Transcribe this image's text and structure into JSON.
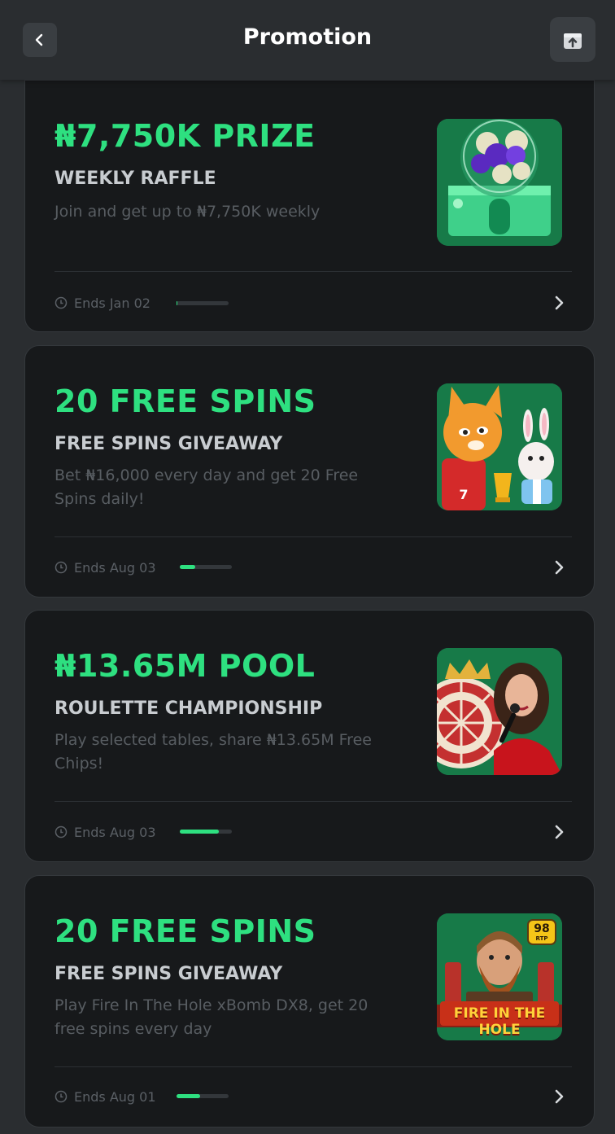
{
  "header": {
    "title": "Promotion",
    "back_icon": "chevron-left-icon",
    "share_icon": "share-upload-icon"
  },
  "colors": {
    "accent": "#2ee080",
    "card_bg": "#17191b",
    "page_bg": "#2a2d30",
    "thumb_bg": "#177a48"
  },
  "promotions": [
    {
      "headline": "₦7,750K PRIZE",
      "subtitle": "WEEKLY RAFFLE",
      "description": "Join and get up to ₦7,750K weekly",
      "ends": "Ends Jan 02",
      "progress": 0.02,
      "thumb_icon": "lottery-machine-icon"
    },
    {
      "headline": "20 FREE SPINS",
      "subtitle": "FREE SPINS GIVEAWAY",
      "description": "Bet ₦16,000 every day and get 20 Free Spins daily!",
      "ends": "Ends Aug 03",
      "progress": 0.3,
      "thumb_icon": "cat-and-rabbit-game-icon"
    },
    {
      "headline": "₦13.65M POOL",
      "subtitle": "ROULETTE CHAMPIONSHIP",
      "description": "Play selected tables, share ₦13.65M Free Chips!",
      "ends": "Ends Aug 03",
      "progress": 0.75,
      "thumb_icon": "roulette-dealer-icon"
    },
    {
      "headline": "20 FREE SPINS",
      "subtitle": "FREE SPINS GIVEAWAY",
      "description": "Play Fire In The Hole xBomb DX8, get 20 free spins every day",
      "ends": "Ends Aug 01",
      "progress": 0.45,
      "thumb_icon": "fire-in-the-hole-game-icon",
      "thumb_logo_text": "FIRE IN THE HOLE",
      "thumb_badge": "98",
      "thumb_badge_sub": "RTP"
    }
  ]
}
